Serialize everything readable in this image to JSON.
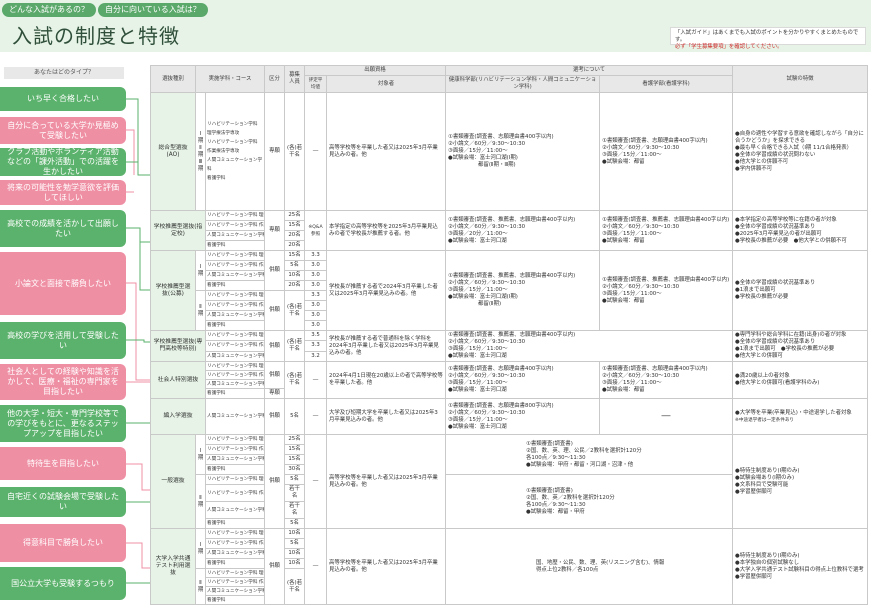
{
  "header": {
    "tabs": [
      "どんな入試があるの？",
      "自分に向いている入試は？"
    ],
    "title": "入試の制度と特徴",
    "note": {
      "line1": "「入試ガイド」はあくまでも入試のポイントを分かりやすくまとめたものです。",
      "line2": "必ず「学生募集要項」を確認してください。"
    }
  },
  "left": {
    "heading": "あなたはどのタイプ？",
    "buttons": [
      {
        "label": "いち早く合格したい",
        "color": "green"
      },
      {
        "label": "自分に合っている大学か見極めて受験したい",
        "color": "pink"
      },
      {
        "label": "クラブ活動やボランティア活動などの「課外活動」での活躍を生かしたい",
        "color": "green"
      },
      {
        "label": "将来の可能性を勉学意欲を評価してほしい",
        "color": "pink"
      },
      {
        "label": "高校での成績を活かして出願したい",
        "color": "green"
      },
      {
        "label": "小論文と面接で勝負したい",
        "color": "pink"
      },
      {
        "label": "高校の学びを活用して受験したい",
        "color": "green"
      },
      {
        "label": "社会人としての経験や知識を活かして、医療・福祉の専門家を目指したい",
        "color": "pink"
      },
      {
        "label": "他の大学・短大・専門学校等での学びをもとに、更なるステップアップを目指したい",
        "color": "green"
      },
      {
        "label": "特待生を目指したい",
        "color": "pink"
      },
      {
        "label": "自宅近くの試験会場で受験したい",
        "color": "green"
      },
      {
        "label": "得意科目で勝負したい",
        "color": "pink"
      },
      {
        "label": "国公立大学も受験するつもり",
        "color": "green"
      }
    ]
  },
  "table": {
    "headers": {
      "type": "選抜種別",
      "dept": "実施学科・コース",
      "kubun": "区分",
      "capacity": "募集人員",
      "qualification": "出願資格",
      "hyotei": "評定平均値",
      "target": "対象者",
      "exam": "選考について",
      "rehab": "健康科学部(リハビリテーション学科・人間コミュニケーション学科)",
      "nursing": "看護学部(看護学科)",
      "features": "試験の特徴"
    },
    "ao": {
      "type": "総合型選抜(AO)",
      "periods": "Ⅰ期 Ⅱ期 Ⅲ期",
      "depts": [
        "リハビリテーション学科 理学療法学専攻",
        "リハビリテーション学科 作業療法学専攻",
        "人間コミュニケーション学科",
        "看護学科"
      ],
      "kubun": "専願",
      "capacity": "(各)若干名",
      "hyotei": "―",
      "target": "高等学校等を卒業した者又は2025年3月卒業見込みの者。他",
      "rehab": [
        "①書類審査(調査書、志願理由書400字以内)",
        "②小論文／60分／9:30～10:30",
        "③面接／15分／11:00～",
        "●試験会場：富士河口湖(Ⅰ期)",
        "都留(Ⅱ期・Ⅲ期)"
      ],
      "nursing": [
        "①書類審査(調査書、志願理由書400字以内)",
        "②小論文／60分／9:30～10:30",
        "③面接／15分／11:00～",
        "●試験会場：都留"
      ],
      "features": [
        "●自身の適性や学習する意欲を確認しながら「自分に合うかどうか」を探求できる",
        "●最も早く合格できる入試（Ⅰ期 11/1合格発表）",
        "●全体の学習成績の状況問わない",
        "●他大学との併願不可",
        "●学内併願不可"
      ]
    },
    "designated": {
      "type": "学校推薦型選抜(指定校)",
      "depts": [
        "リハビリテーション学科 理学療法学専攻",
        "リハビリテーション学科 作業療法学専攻",
        "人間コミュニケーション学科",
        "看護学科"
      ],
      "capacities": [
        "25名",
        "15名",
        "20名",
        "20名"
      ],
      "kubun": "専願",
      "hyotei": "※Q&A参照",
      "target": "本学指定の高等学校等を2025年3月卒業見込みの者で学校長が推薦する者。他",
      "rehab": [
        "①書類審査(調査書、推薦書、志願理由書400字以内)",
        "②小論文／60分／9:30～10:30",
        "③面接／20分／11:00～",
        "●試験会場：富士河口湖"
      ],
      "nursing": [
        "①書類審査(調査書、推薦書、志願理由書400字以内)",
        "②小論文／60分／9:30～10:30",
        "③面接／15分／11:00～",
        "●試験会場：都留"
      ],
      "features": [
        "●本学指定の高等学校等に在籍の者が対象",
        "●全体の学習成績の状況基準あり",
        "●2025年3月卒業見込の者が出願可",
        "●学校長の推薦が必要　●他大学との併願不可"
      ]
    },
    "public": {
      "type": "学校推薦型選抜(公募)",
      "period1": "Ⅰ期",
      "period2": "Ⅱ期",
      "depts": [
        "リハビリテーション学科 理学療法学専攻",
        "リハビリテーション学科 作業療法学専攻",
        "人間コミュニケーション学科",
        "看護学科"
      ],
      "caps1": [
        "15名",
        "5名",
        "10名",
        "20名"
      ],
      "hyotei1": [
        "3.3",
        "3.0",
        "3.0",
        "3.0"
      ],
      "cap2": "(各)若干名",
      "hyotei2": [
        "3.3",
        "3.0",
        "3.0",
        "3.0"
      ],
      "kubun": "併願",
      "target": "学校長が推薦する者で2024年3月卒業した者又は2025年3月卒業見込みの者。他",
      "rehab": [
        "①書類審査(調査書、推薦書、志願理由書400字以内)",
        "②小論文／60分／9:30～10:30",
        "③面接／15分／11:00～",
        "●試験会場：富士河口湖(Ⅰ期)",
        "都留(Ⅱ期)"
      ],
      "nursing": [
        "①書類審査(調査書、推薦書、志願理由書400字以内)",
        "②小論文／60分／9:30～10:30",
        "③面接／15分／11:00～",
        "●試験会場：都留"
      ],
      "features": [
        "●全体の学習成績の状況基準あり",
        "●1浪まで出願可",
        "●学校長の推薦が必要"
      ]
    },
    "specialized": {
      "type": "学校推薦型選抜(専門高校等特別)",
      "depts": [
        "リハビリテーション学科 理学療法学専攻",
        "リハビリテーション学科 作業療法学専攻",
        "人間コミュニケーション学科"
      ],
      "capacity": "(各)若干名",
      "kubun": "併願",
      "hyotei": [
        "3.5",
        "3.3",
        "3.2"
      ],
      "target": "学校長が推薦する者で普通科を除く学科を2024年3月卒業した者又は2025年3月卒業見込みの者。他",
      "rehab": [
        "①書類審査(調査書、推薦書、志願理由書400字以内)",
        "②小論文／60分／9:30～10:30",
        "③面接／15分／11:00～",
        "●試験会場：富士河口湖"
      ],
      "features": [
        "●専門学科や総合学科に在籍(出身)の者が対象",
        "●全体の学習成績の状況基準あり",
        "●1浪まで出願可　●学校長の推薦が必要",
        "●他大学との併願可"
      ]
    },
    "adult": {
      "type": "社会人特別選抜",
      "depts": [
        "リハビリテーション学科 理学療法学専攻",
        "リハビリテーション学科 作業療法学専攻",
        "人間コミュニケーション学科",
        "看護学科"
      ],
      "kubun1": "併願",
      "kubun2": "専願",
      "capacity": "(各)若干名",
      "hyotei": "―",
      "target": "2024年4月1日現在20歳以上の者で高等学校等を卒業した者。他",
      "rehab": [
        "①書類審査(調査書、志願理由書400字以内)",
        "②小論文／60分／9:30～10:30",
        "③面接／15分／11:00～",
        "●試験会場：富士河口湖"
      ],
      "nursing": [
        "①書類審査(調査書、志願理由書400字以内)",
        "②小論文／60分／9:30～10:30",
        "③面接／15分／11:00～",
        "●試験会場：都留"
      ],
      "features": [
        "●満20歳以上の者対象",
        "●他大学との併願可(看護学科のみ)"
      ]
    },
    "transfer": {
      "type": "編入学選抜",
      "dept": "人間コミュニケーション学科",
      "kubun": "併願",
      "capacity": "5名",
      "target": "大学及び短期大学を卒業した者又は2025年3月卒業見込みの者。他",
      "rehab": [
        "①書類審査(調査書、志願理由書800字以内)",
        "②小論文／60分／9:30～10:30",
        "③面接／15分／11:00～",
        "●試験会場：富士河口湖"
      ],
      "nursing": "―",
      "features": [
        "●大学等を卒業(卒業見込)・中途退学した者対象",
        "※中途退学者は一定条件あり"
      ]
    },
    "general": {
      "type": "一般選抜",
      "period1": "Ⅰ期",
      "period2": "Ⅱ期",
      "depts": [
        "リハビリテーション学科 理学療法学専攻",
        "リハビリテーション学科 作業療法学専攻",
        "人間コミュニケーション学科",
        "看護学科"
      ],
      "caps1": [
        "25名",
        "15名",
        "15名",
        "30名"
      ],
      "caps2": [
        "5名",
        "若干名",
        "若干名",
        "5名"
      ],
      "kubun": "併願",
      "target": "高等学校等を卒業した者又は2025年3月卒業見込みの者。他",
      "exam1": [
        "①書類審査(調査書)",
        "②国、数、英、理、公民／2教科を選択計120分",
        "各100点／9:30～11:30",
        "●試験会場：甲府・都留・河口湖・沼津・他"
      ],
      "exam2": [
        "①書類審査(調査書)",
        "②国、数、英／2教科を選択計120分",
        "各100点／9:30～11:30",
        "●試験会場：都留・甲府"
      ],
      "features": [
        "●特待生制度あり(Ⅰ期のみ)",
        "●試験会場あり(Ⅰ期のみ)",
        "●文系科目で受験可能",
        "●学習歴併願可"
      ]
    },
    "common": {
      "type": "大学入学共通テスト利用選抜",
      "period1": "Ⅰ期",
      "period2": "Ⅱ期",
      "depts": [
        "リハビリテーション学科 理学療法学専攻",
        "リハビリテーション学科 作業療法学専攻",
        "人間コミュニケーション学科",
        "看護学科"
      ],
      "caps1": [
        "10名",
        "5名",
        "10名",
        "10名"
      ],
      "cap2": "(各)若干名",
      "kubun": "併願",
      "hyotei": "―",
      "target": "高等学校等を卒業した者又は2025年3月卒業見込みの者。他",
      "exam": [
        "国、地歴・公民、数、理、英(リスニング含む)、情報",
        "得点上位2教科／各100点"
      ],
      "features": [
        "●特待生制度あり(Ⅰ期のみ)",
        "●本学独自の個別試験なし",
        "●大学入学共通テスト試験科目の得点上位教科で選考",
        "●学習歴併願可"
      ]
    }
  }
}
